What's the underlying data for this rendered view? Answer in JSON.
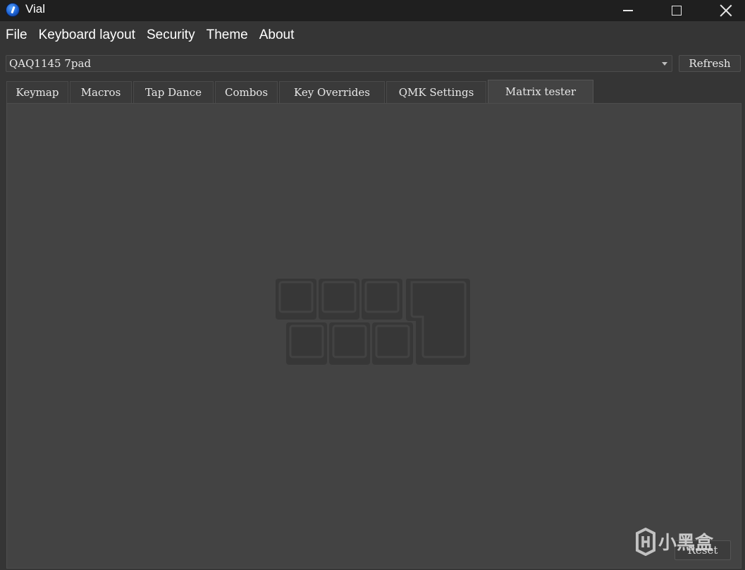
{
  "window": {
    "title": "Vial"
  },
  "menu": [
    "File",
    "Keyboard layout",
    "Security",
    "Theme",
    "About"
  ],
  "device_selector": {
    "value": "QAQ1145 7pad"
  },
  "refresh_label": "Refresh",
  "tabs": [
    {
      "label": "Keymap",
      "active": false
    },
    {
      "label": "Macros",
      "active": false
    },
    {
      "label": "Tap Dance",
      "active": false
    },
    {
      "label": "Combos",
      "active": false
    },
    {
      "label": "Key Overrides",
      "active": false
    },
    {
      "label": "QMK Settings",
      "active": false
    },
    {
      "label": "Matrix tester",
      "active": true
    }
  ],
  "panel": {
    "reset_label": "Reset"
  },
  "watermark": {
    "text": "小黑盒"
  },
  "colors": {
    "titlebar": "#1f1f1f",
    "background": "#353535",
    "panel": "#434343",
    "text": "#e8e8e8"
  }
}
